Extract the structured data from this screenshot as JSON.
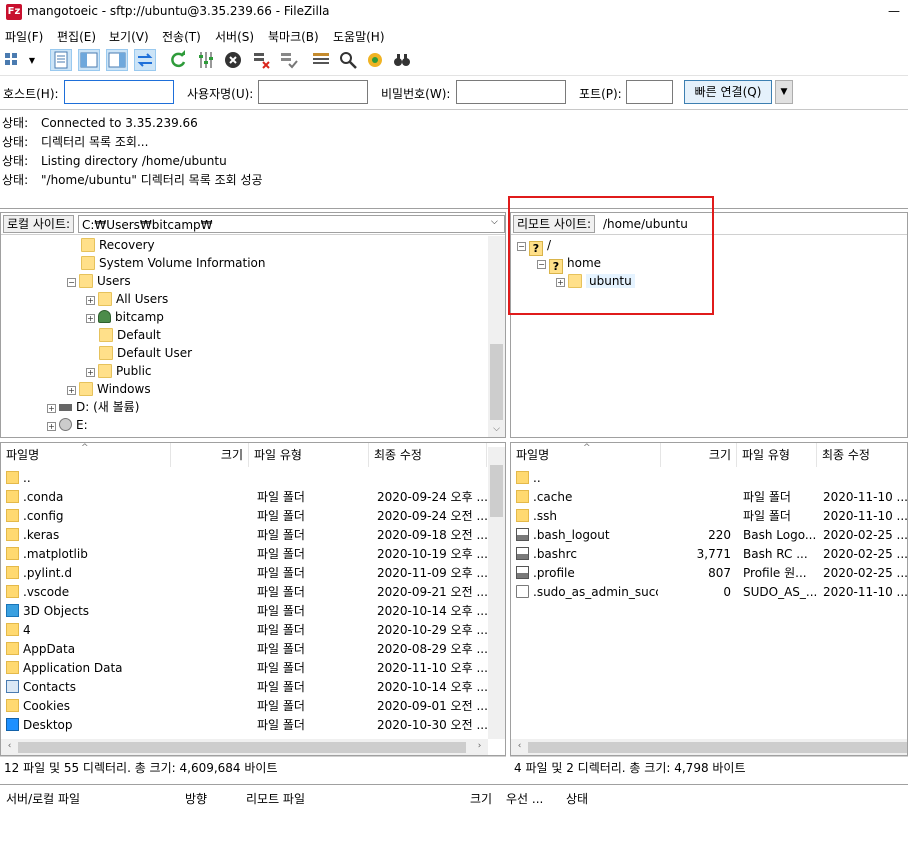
{
  "window": {
    "app_icon_letter": "Fz",
    "title": "mangotoeic - sftp://ubuntu@3.35.239.66 - FileZilla"
  },
  "menu": [
    "파일(F)",
    "편집(E)",
    "보기(V)",
    "전송(T)",
    "서버(S)",
    "북마크(B)",
    "도움말(H)"
  ],
  "toolbar_icons": [
    "site-manager-icon",
    "message-log-icon",
    "local-tree-icon",
    "remote-tree-icon",
    "transfer-queue-icon",
    "refresh-icon",
    "filter-icon",
    "cancel-icon",
    "disconnect-icon",
    "reconnect-icon",
    "toggle-filter-icon",
    "search-icon",
    "compare-icon",
    "find-icon"
  ],
  "quickconnect": {
    "host_label": "호스트(H):",
    "host_value": "",
    "user_label": "사용자명(U):",
    "user_value": "",
    "pass_label": "비밀번호(W):",
    "pass_value": "",
    "port_label": "포트(P):",
    "port_value": "",
    "connect_button": "빠른 연결(Q)",
    "dropdown_glyph": "▼"
  },
  "log": [
    {
      "key": "상태:",
      "text": "Connected to 3.35.239.66"
    },
    {
      "key": "상태:",
      "text": "디렉터리 목록 조회..."
    },
    {
      "key": "상태:",
      "text": "Listing directory /home/ubuntu"
    },
    {
      "key": "상태:",
      "text": "\"/home/ubuntu\" 디렉터리 목록 조회 성공"
    }
  ],
  "local": {
    "site_label": "로컬 사이트:",
    "path": "C:₩Users₩bitcamp₩",
    "tree": [
      "Recovery",
      "System Volume Information",
      "Users",
      "All Users",
      "bitcamp",
      "Default",
      "Default User",
      "Public",
      "Windows",
      "D: (새 볼륨)",
      "E:"
    ],
    "columns": [
      "파일명",
      "크기",
      "파일 유형",
      "최종 수정"
    ],
    "files": [
      {
        "name": "..",
        "size": "",
        "type": "",
        "modified": ""
      },
      {
        "name": ".conda",
        "size": "",
        "type": "파일 폴더",
        "modified": "2020-09-24 오후 ..."
      },
      {
        "name": ".config",
        "size": "",
        "type": "파일 폴더",
        "modified": "2020-09-24 오전 ..."
      },
      {
        "name": ".keras",
        "size": "",
        "type": "파일 폴더",
        "modified": "2020-09-18 오전 ..."
      },
      {
        "name": ".matplotlib",
        "size": "",
        "type": "파일 폴더",
        "modified": "2020-10-19 오후 ..."
      },
      {
        "name": ".pylint.d",
        "size": "",
        "type": "파일 폴더",
        "modified": "2020-11-09 오후 ..."
      },
      {
        "name": ".vscode",
        "size": "",
        "type": "파일 폴더",
        "modified": "2020-09-21 오전 ..."
      },
      {
        "name": "3D Objects",
        "size": "",
        "type": "파일 폴더",
        "modified": "2020-10-14 오후 ..."
      },
      {
        "name": "4",
        "size": "",
        "type": "파일 폴더",
        "modified": "2020-10-29 오후 ..."
      },
      {
        "name": "AppData",
        "size": "",
        "type": "파일 폴더",
        "modified": "2020-08-29 오후 ..."
      },
      {
        "name": "Application Data",
        "size": "",
        "type": "파일 폴더",
        "modified": "2020-11-10 오후 ..."
      },
      {
        "name": "Contacts",
        "size": "",
        "type": "파일 폴더",
        "modified": "2020-10-14 오후 ..."
      },
      {
        "name": "Cookies",
        "size": "",
        "type": "파일 폴더",
        "modified": "2020-09-01 오전 ..."
      },
      {
        "name": "Desktop",
        "size": "",
        "type": "파일 폴더",
        "modified": "2020-10-30 오전 ..."
      }
    ],
    "status": "12 파일 및 55 디렉터리. 총 크기: 4,609,684 바이트"
  },
  "remote": {
    "site_label": "리모트 사이트:",
    "path": "/home/ubuntu",
    "tree": [
      "/",
      "home",
      "ubuntu"
    ],
    "columns": [
      "파일명",
      "크기",
      "파일 유형",
      "최종 수정"
    ],
    "files": [
      {
        "name": "..",
        "size": "",
        "type": "",
        "modified": ""
      },
      {
        "name": ".cache",
        "size": "",
        "type": "파일 폴더",
        "modified": "2020-11-10 ..."
      },
      {
        "name": ".ssh",
        "size": "",
        "type": "파일 폴더",
        "modified": "2020-11-10 ..."
      },
      {
        "name": ".bash_logout",
        "size": "220",
        "type": "Bash Logo...",
        "modified": "2020-02-25 ..."
      },
      {
        "name": ".bashrc",
        "size": "3,771",
        "type": "Bash RC ...",
        "modified": "2020-02-25 ..."
      },
      {
        "name": ".profile",
        "size": "807",
        "type": "Profile 원...",
        "modified": "2020-02-25 ..."
      },
      {
        "name": ".sudo_as_admin_succ...",
        "size": "0",
        "type": "SUDO_AS_...",
        "modified": "2020-11-10 ..."
      }
    ],
    "status": "4 파일 및 2 디렉터리. 총 크기: 4,798 바이트"
  },
  "queue": {
    "columns": [
      "서버/로컬 파일",
      "방향",
      "리모트 파일",
      "크기",
      "우선 ...",
      "상태"
    ]
  },
  "colors": {
    "highlight": "#e01b1b",
    "connect_button": "#e5f1fb"
  }
}
